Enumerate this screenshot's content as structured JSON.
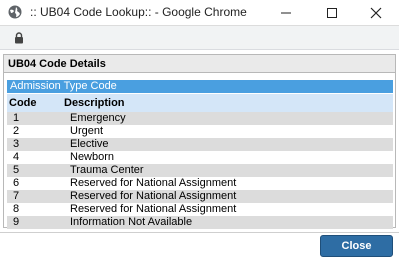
{
  "window": {
    "title": ":: UB04 Code Lookup:: - Google Chrome",
    "app_icon": "globe-icon",
    "controls": [
      "minimize-icon",
      "maximize-icon",
      "close-icon"
    ]
  },
  "address_bar": {
    "icon": "lock-icon",
    "url": ""
  },
  "panel": {
    "title": "UB04 Code Details",
    "section": "Admission Type Code",
    "columns": {
      "code": "Code",
      "description": "Description"
    },
    "rows": [
      {
        "code": "1",
        "description": "Emergency"
      },
      {
        "code": "2",
        "description": "Urgent"
      },
      {
        "code": "3",
        "description": "Elective"
      },
      {
        "code": "4",
        "description": "Newborn"
      },
      {
        "code": "5",
        "description": "Trauma Center"
      },
      {
        "code": "6",
        "description": "Reserved for National Assignment"
      },
      {
        "code": "7",
        "description": "Reserved for National Assignment"
      },
      {
        "code": "8",
        "description": "Reserved for National Assignment"
      },
      {
        "code": "9",
        "description": "Information Not Available"
      }
    ]
  },
  "footer": {
    "close_label": "Close"
  },
  "colors": {
    "section_header": "#4a9fe0",
    "column_header": "#d4e6f8",
    "odd_row": "#dcdcdc",
    "close_button": "#2e6da4"
  }
}
